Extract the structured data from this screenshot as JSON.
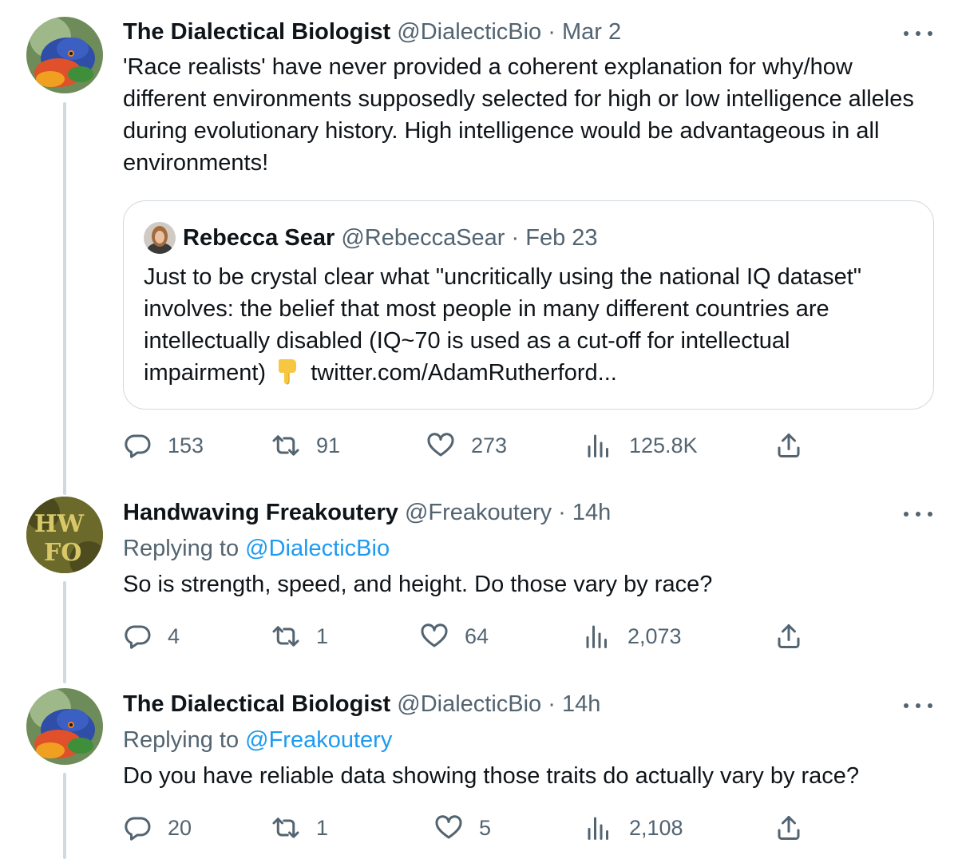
{
  "tweets": [
    {
      "author_name": "The Dialectical Biologist",
      "handle": "@DialecticBio",
      "time": "Mar 2",
      "body": "'Race realists' have never provided a coherent explanation for why/how different environments supposedly selected for high or low intelligence alleles during evolutionary history. High intelligence would be advantageous in all environments!",
      "quote": {
        "author_name": "Rebecca Sear",
        "handle": "@RebeccaSear",
        "time": "Feb 23",
        "body": "Just to be crystal clear what \"uncritically using the national IQ dataset\" involves: the belief that most people in many different countries are intellectually disabled (IQ~70 is used as a cut-off for intellectual impairment)",
        "link": "twitter.com/AdamRutherford..."
      },
      "stats": {
        "replies": "153",
        "retweets": "91",
        "likes": "273",
        "views": "125.8K"
      }
    },
    {
      "author_name": "Handwaving Freakoutery",
      "handle": "@Freakoutery",
      "time": "14h",
      "replying_label": "Replying to",
      "replying_to": "@DialecticBio",
      "body": "So is strength, speed, and height. Do those vary by race?",
      "stats": {
        "replies": "4",
        "retweets": "1",
        "likes": "64",
        "views": "2,073"
      }
    },
    {
      "author_name": "The Dialectical Biologist",
      "handle": "@DialecticBio",
      "time": "14h",
      "replying_label": "Replying to",
      "replying_to": "@Freakoutery",
      "body": "Do you have reliable data showing those traits do actually vary by race?",
      "stats": {
        "replies": "20",
        "retweets": "1",
        "likes": "5",
        "views": "2,108"
      }
    }
  ],
  "separator": " · ",
  "icons": [
    "reply-icon",
    "retweet-icon",
    "like-icon",
    "views-icon",
    "share-icon",
    "more-icon",
    "pointing-down-icon"
  ],
  "colors": {
    "text": "#0f1419",
    "secondary": "#536471",
    "link": "#1d9bf0",
    "border": "#cfd9de"
  }
}
